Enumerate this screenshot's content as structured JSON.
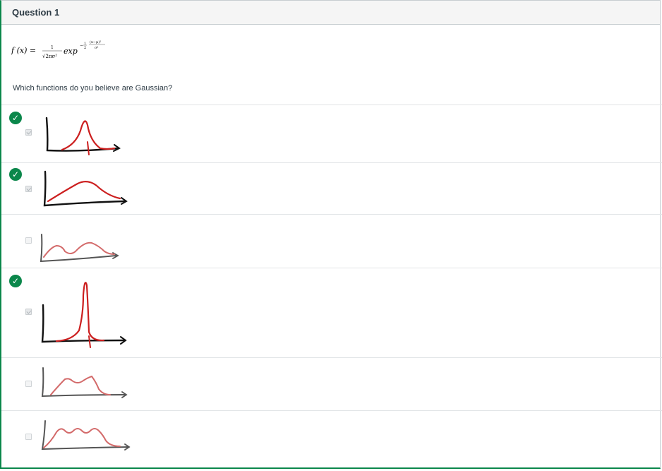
{
  "question": {
    "title": "Question 1",
    "formula": {
      "lhs": "f (x) =",
      "numerator": "1",
      "denominator": "√2πσ²",
      "function_name": "exp",
      "exponent_sign": "−",
      "exponent_coef_num": "1",
      "exponent_coef_den": "2",
      "exponent_num": "(x−μ)²",
      "exponent_den": "σ²"
    },
    "prompt": "Which functions do you believe are Gaussian?"
  },
  "answers": [
    {
      "selected": true,
      "correct": true,
      "image": "narrow-gaussian-sketch"
    },
    {
      "selected": true,
      "correct": true,
      "image": "wide-gaussian-sketch"
    },
    {
      "selected": false,
      "correct": false,
      "image": "bimodal-curve-sketch"
    },
    {
      "selected": true,
      "correct": true,
      "image": "tall-narrow-gaussian-sketch"
    },
    {
      "selected": false,
      "correct": false,
      "image": "double-hump-curve-sketch"
    },
    {
      "selected": false,
      "correct": false,
      "image": "wavy-multi-peak-curve-sketch"
    }
  ],
  "icons": {
    "correct": "checkmark-circle-icon",
    "checkmark_glyph": "✓"
  },
  "colors": {
    "correct_green": "#0b874b",
    "sketch_red": "#cc1f1f",
    "sketch_black": "#111111"
  }
}
